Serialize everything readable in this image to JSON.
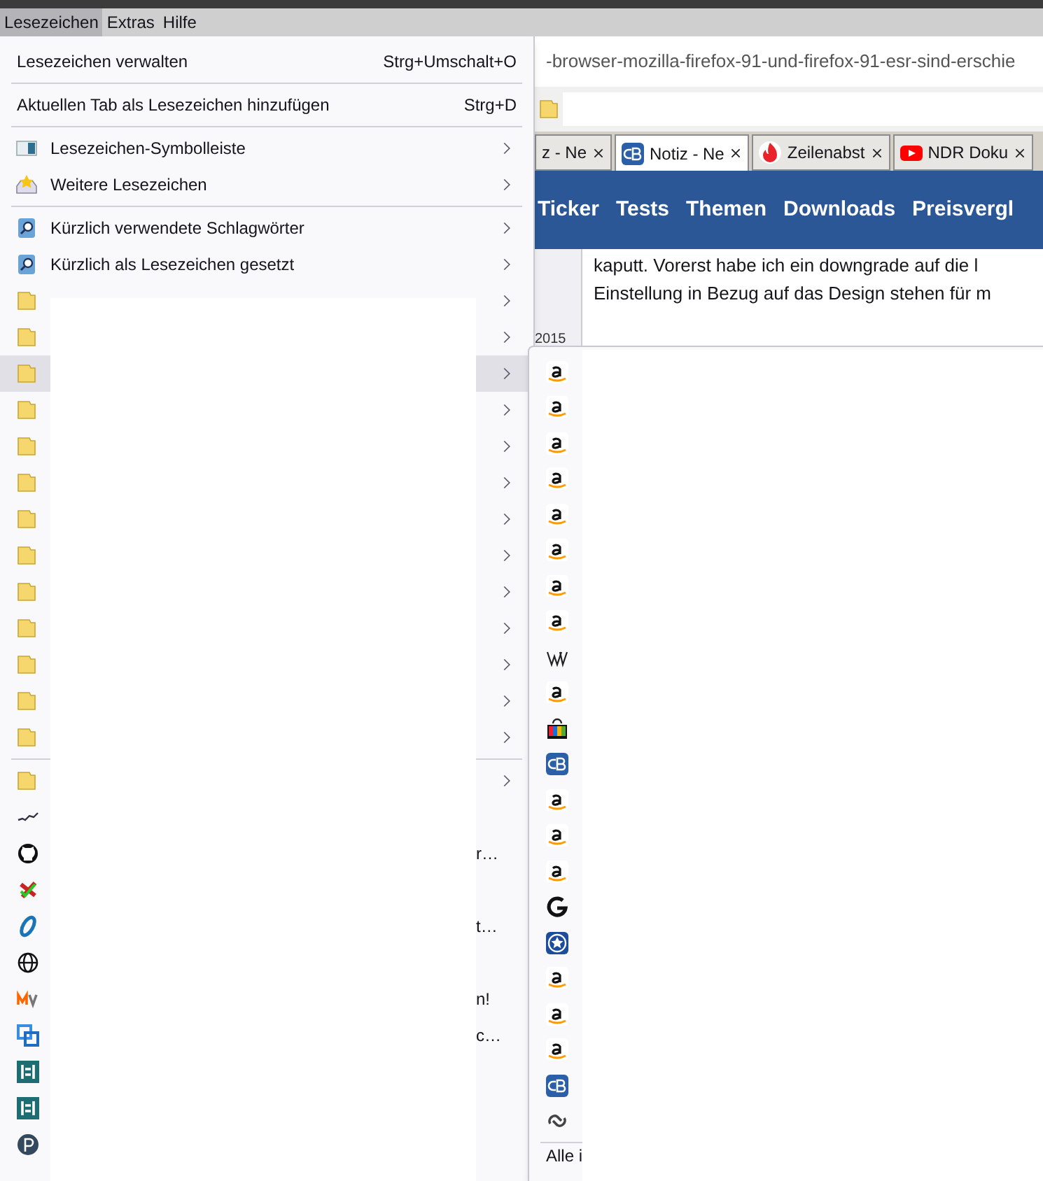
{
  "menubar": [
    {
      "label": "Lesezeichen",
      "selected": true
    },
    {
      "label": "Extras",
      "selected": false
    },
    {
      "label": "Hilfe",
      "selected": false
    }
  ],
  "browser": {
    "address": "-browser-mozilla-firefox-91-und-firefox-91-esr-sind-erschie",
    "tabs": [
      {
        "label": "z - Ne",
        "selected": false
      },
      {
        "label": "Notiz - Ne",
        "selected": true
      },
      {
        "label": "Zeilenabst",
        "selected": false
      },
      {
        "label": "NDR Doku",
        "selected": false
      }
    ],
    "nav": [
      "Ticker",
      "Tests",
      "Themen",
      "Downloads",
      "Preisvergl"
    ],
    "content": [
      "kaputt. Vorerst habe ich ein downgrade auf die l",
      "Einstellung in Bezug auf das Design stehen für m"
    ],
    "side_label": "2015"
  },
  "bookmarks_menu": {
    "items": [
      {
        "kind": "command",
        "label": "Lesezeichen verwalten",
        "shortcut": "Strg+Umschalt+O"
      },
      {
        "kind": "separator"
      },
      {
        "kind": "command",
        "label": "Aktuellen Tab als Lesezeichen hinzufügen",
        "shortcut": "Strg+D"
      },
      {
        "kind": "separator"
      },
      {
        "kind": "submenu",
        "label": "Lesezeichen-Symbolleiste",
        "selected": false
      },
      {
        "kind": "submenu",
        "label": "Weitere Lesezeichen",
        "selected": false
      },
      {
        "kind": "separator"
      },
      {
        "kind": "submenu",
        "label": "Kürzlich verwendete Schlagwörter",
        "selected": false
      },
      {
        "kind": "submenu",
        "label": "Kürzlich als Lesezeichen gesetzt",
        "selected": false
      },
      {
        "kind": "folder",
        "selected": false
      },
      {
        "kind": "folder",
        "selected": false
      },
      {
        "kind": "folder",
        "selected": true
      },
      {
        "kind": "folder",
        "selected": false
      },
      {
        "kind": "folder",
        "selected": false
      },
      {
        "kind": "folder",
        "selected": false
      },
      {
        "kind": "folder",
        "selected": false
      },
      {
        "kind": "folder",
        "selected": false
      },
      {
        "kind": "folder",
        "selected": false
      },
      {
        "kind": "folder",
        "selected": false
      },
      {
        "kind": "folder",
        "selected": false
      },
      {
        "kind": "folder",
        "selected": false
      },
      {
        "kind": "folder",
        "selected": false
      },
      {
        "kind": "separator"
      },
      {
        "kind": "folder",
        "selected": false
      },
      {
        "kind": "bookmark"
      },
      {
        "kind": "bookmark",
        "label": "r…"
      },
      {
        "kind": "bookmark"
      },
      {
        "kind": "bookmark",
        "label": "t…"
      },
      {
        "kind": "bookmark"
      },
      {
        "kind": "bookmark",
        "label": "n!"
      },
      {
        "kind": "bookmark",
        "label": "c…"
      },
      {
        "kind": "bookmark"
      },
      {
        "kind": "bookmark"
      },
      {
        "kind": "bookmark"
      }
    ]
  },
  "folder_submenu": {
    "items": [
      {
        "kind": "bookmark"
      },
      {
        "kind": "bookmark"
      },
      {
        "kind": "bookmark"
      },
      {
        "kind": "bookmark"
      },
      {
        "kind": "bookmark"
      },
      {
        "kind": "bookmark"
      },
      {
        "kind": "bookmark"
      },
      {
        "kind": "bookmark"
      },
      {
        "kind": "bookmark"
      },
      {
        "kind": "bookmark"
      },
      {
        "kind": "bookmark"
      },
      {
        "kind": "bookmark"
      },
      {
        "kind": "bookmark"
      },
      {
        "kind": "bookmark"
      },
      {
        "kind": "bookmark"
      },
      {
        "kind": "bookmark"
      },
      {
        "kind": "bookmark"
      },
      {
        "kind": "bookmark"
      },
      {
        "kind": "bookmark"
      },
      {
        "kind": "bookmark"
      },
      {
        "kind": "bookmark"
      },
      {
        "kind": "bookmark"
      }
    ],
    "footer": "Alle i"
  }
}
